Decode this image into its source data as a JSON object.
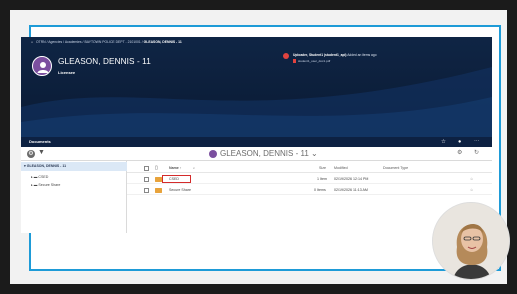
{
  "breadcrumb": {
    "path": "OTRN / Agencies / Academies / BAYTOWN POLICE DEPT - 2101001 /",
    "current": "GLEASON, DENNIS - 11"
  },
  "profile": {
    "name": "GLEASON, DENNIS - 11",
    "subtitle": "Licensee"
  },
  "upload": {
    "title": "Uploader, Student1 (student1_api)",
    "suffix": "Added an items ago",
    "file": "student1_user_doc1.pdf"
  },
  "documents_bar": {
    "label": "Documents",
    "icons": [
      "star-icon",
      "person-icon",
      "more-icon"
    ]
  },
  "toolbar": {
    "title": "GLEASON, DENNIS - 11",
    "icons": [
      "settings-icon",
      "filter-icon",
      "gear-icon",
      "refresh-icon"
    ]
  },
  "tree": {
    "root": "GLEASON, DENNIS - 11",
    "items": [
      "CSED",
      "Secure Share"
    ]
  },
  "grid": {
    "columns": {
      "name": "Name",
      "size": "Size",
      "modified": "Modified",
      "document_type": "Document Type"
    },
    "rows": [
      {
        "name": "CSED",
        "size": "1 Item",
        "modified": "02/19/2026 12:14 PM"
      },
      {
        "name": "Secure Share",
        "size": "0 Items",
        "modified": "02/19/2026 11:13 AM"
      }
    ]
  },
  "colors": {
    "accent": "#1e9bd7",
    "header_dark": "#0d2142",
    "avatar_purple": "#7b4f9f",
    "folder": "#e8a33b",
    "highlight": "#d42b2b"
  }
}
